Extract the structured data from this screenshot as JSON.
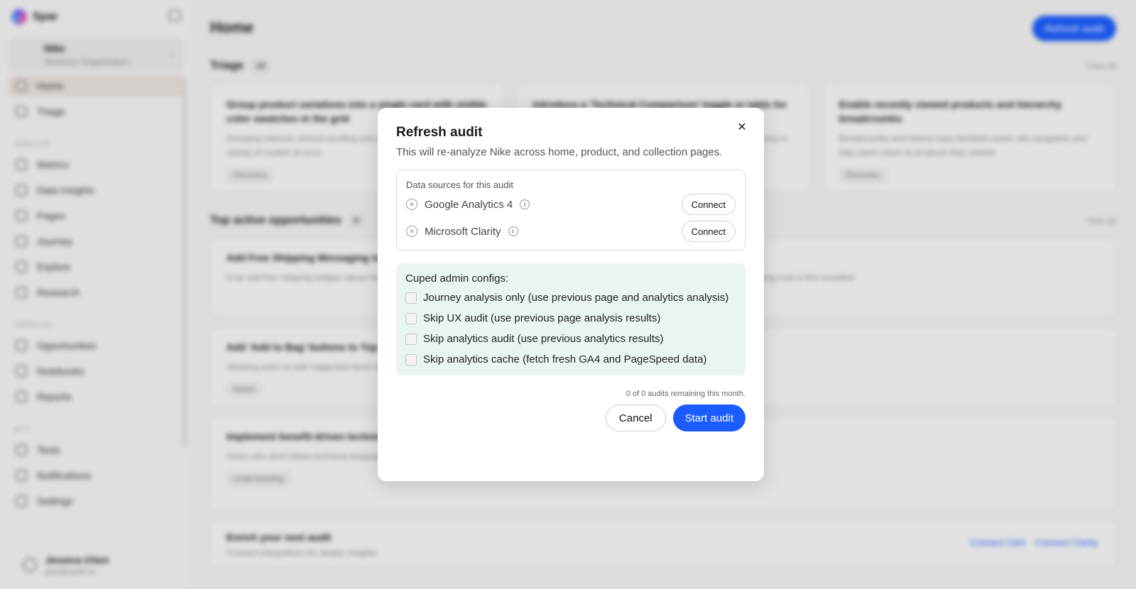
{
  "sidebar": {
    "brand": "Spar",
    "org_name": "Nike",
    "org_sub": "Jessica's Organization",
    "nav_top": [
      {
        "label": "Home",
        "icon": "home-icon"
      },
      {
        "label": "Triage",
        "icon": "inbox-icon"
      }
    ],
    "section_analyze": "ANALYZE",
    "nav_analyze": [
      {
        "label": "Metrics",
        "icon": "chart-icon"
      },
      {
        "label": "Data insights",
        "icon": "database-icon"
      },
      {
        "label": "Pages",
        "icon": "pages-icon"
      },
      {
        "label": "Journey",
        "icon": "journey-icon"
      },
      {
        "label": "Explore",
        "icon": "explore-icon"
      },
      {
        "label": "Research",
        "icon": "research-icon"
      }
    ],
    "section_improve": "IMPROVE",
    "nav_improve": [
      {
        "label": "Opportunities",
        "icon": "target-icon"
      },
      {
        "label": "Notebooks",
        "icon": "notebook-icon"
      },
      {
        "label": "Reports",
        "icon": "report-icon"
      }
    ],
    "section_act": "ACT",
    "nav_act": [
      {
        "label": "Tests",
        "icon": "flask-icon"
      },
      {
        "label": "Notifications",
        "icon": "bell-icon"
      },
      {
        "label": "Settings",
        "icon": "gear-icon"
      }
    ],
    "user_name": "Jessica Chen",
    "user_email": "jess@spark.ai"
  },
  "main": {
    "title": "Home",
    "refresh_label": "Refresh audit",
    "triage_title": "Triage",
    "triage_count": "16",
    "view_all": "View all",
    "triage_cards": [
      {
        "title": "Group product variations into a single card with visible color swatches in the grid",
        "text": "Grouping reduces vertical scrolling and allows users to see a wider variety of models at once.",
        "tag": "Discovery"
      },
      {
        "title": "Introduce a 'Technical Comparison' toggle or table for product categories",
        "text": "Shoppers compare specs across products and need a faster way to evaluate options side by side.",
        "tag": "Discovery"
      },
      {
        "title": "Enable recently viewed products and hierarchy breadcrumbs",
        "text": "Breadcrumbs and history trays facilitate easier site navigation and help users return to products they viewed.",
        "tag": "Discovery"
      }
    ],
    "opps_title": "Top active opportunities",
    "opps_count": "8",
    "opps": [
      {
        "title": "Add Free Shipping Messaging to product pages",
        "text": "If we add free shipping badges above the fold, we expect to reduce abandonment because 38% of users abandon before checkout when shipping cost is first revealed.",
        "tag": ""
      },
      {
        "title": "Add 'Add to Bag' buttons to Top Picks",
        "text": "Allowing users to add suggested items directly from the carousel reduces friction when desire is high.",
        "tag": "Desire"
      },
      {
        "title": "Implement benefit-driven technical summaries, Fit, Impact, and TPU",
        "text": "Users who don't follow technical language bounce; summaries reduce the need for external research and keep them in the purchase funnel.",
        "tag": "Understanding"
      }
    ],
    "enrich_title": "Enrich your next audit",
    "enrich_text": "Connect integrations for deeper insights",
    "enrich_link_1": "Connect GA4",
    "enrich_link_2": "Connect Clarity"
  },
  "modal": {
    "title": "Refresh audit",
    "description": "This will re-analyze Nike across home, product, and collection pages.",
    "sources_heading": "Data sources for this audit",
    "sources": [
      {
        "name": "Google Analytics 4",
        "action": "Connect"
      },
      {
        "name": "Microsoft Clarity",
        "action": "Connect"
      }
    ],
    "admin_title": "Cuped admin configs:",
    "options": [
      {
        "label": "Journey analysis only (use previous page and analytics analysis)",
        "checked": false
      },
      {
        "label": "Skip UX audit (use previous page analysis results)",
        "checked": false
      },
      {
        "label": "Skip analytics audit (use previous analytics results)",
        "checked": false
      },
      {
        "label": "Skip analytics cache (fetch fresh GA4 and PageSpeed data)",
        "checked": false
      }
    ],
    "remaining": "0 of 0 audits remaining this month.",
    "cancel_label": "Cancel",
    "start_label": "Start audit",
    "close_glyph": "✕",
    "source_status_glyph": "✕",
    "info_glyph": "i"
  },
  "colors": {
    "accent": "#1a5cff",
    "admin_bg": "#e9f6f0"
  }
}
